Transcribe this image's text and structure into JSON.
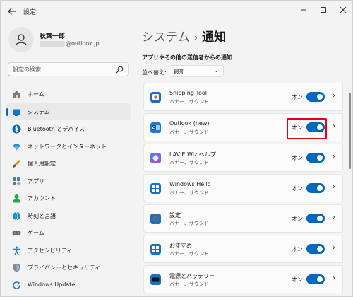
{
  "window": {
    "title": "設定",
    "back_icon": "back-arrow-icon",
    "minimize_icon": "minimize-icon",
    "maximize_icon": "maximize-icon",
    "close_icon": "close-icon"
  },
  "user": {
    "name": "秋葉一郎",
    "email": "@outlook.jp"
  },
  "search": {
    "placeholder": "設定の検索"
  },
  "sidebar": {
    "items": [
      {
        "label": "ホーム",
        "icon": "home-icon",
        "active": false
      },
      {
        "label": "システム",
        "icon": "system-icon",
        "active": true
      },
      {
        "label": "Bluetooth とデバイス",
        "icon": "bluetooth-icon",
        "active": false
      },
      {
        "label": "ネットワークとインターネット",
        "icon": "network-icon",
        "active": false
      },
      {
        "label": "個人用設定",
        "icon": "personalization-icon",
        "active": false
      },
      {
        "label": "アプリ",
        "icon": "apps-icon",
        "active": false
      },
      {
        "label": "アカウント",
        "icon": "account-icon",
        "active": false
      },
      {
        "label": "時刻と言語",
        "icon": "time-language-icon",
        "active": false
      },
      {
        "label": "ゲーム",
        "icon": "gaming-icon",
        "active": false
      },
      {
        "label": "アクセシビリティ",
        "icon": "accessibility-icon",
        "active": false
      },
      {
        "label": "プライバシーとセキュリティ",
        "icon": "privacy-icon",
        "active": false
      },
      {
        "label": "Windows Update",
        "icon": "windows-update-icon",
        "active": false
      }
    ]
  },
  "breadcrumb": {
    "parent": "システム",
    "separator": "›",
    "current": "通知"
  },
  "section": {
    "title": "アプリやその他の送信者からの通知"
  },
  "sort": {
    "label": "並べ替え:",
    "value": "最新"
  },
  "apps": [
    {
      "name": "Snipping Tool",
      "sub": "バナー、サウンド",
      "toggle_label": "オン",
      "on": true,
      "icon": "snipping-tool-icon"
    },
    {
      "name": "Outlook (new)",
      "sub": "バナー、サウンド",
      "toggle_label": "オン",
      "on": true,
      "icon": "outlook-icon",
      "highlighted": true
    },
    {
      "name": "LAVIE Wiz ヘルプ",
      "sub": "バナー、サウンド",
      "toggle_label": "オン",
      "on": true,
      "icon": "lavie-wiz-icon"
    },
    {
      "name": "Windows Hello",
      "sub": "バナー、サウンド",
      "toggle_label": "オン",
      "on": true,
      "icon": "windows-hello-icon"
    },
    {
      "name": "設定",
      "sub": "バナー、サウンド",
      "toggle_label": "オン",
      "on": true,
      "icon": "settings-icon"
    },
    {
      "name": "おすすめ",
      "sub": "バナー、サウンド",
      "toggle_label": "オン",
      "on": true,
      "icon": "suggestions-icon"
    },
    {
      "name": "電源とバッテリー",
      "sub": "バナー、サウンド",
      "toggle_label": "オン",
      "on": true,
      "icon": "power-battery-icon"
    }
  ],
  "colors": {
    "accent": "#0067c0",
    "highlight": "#e60012"
  }
}
